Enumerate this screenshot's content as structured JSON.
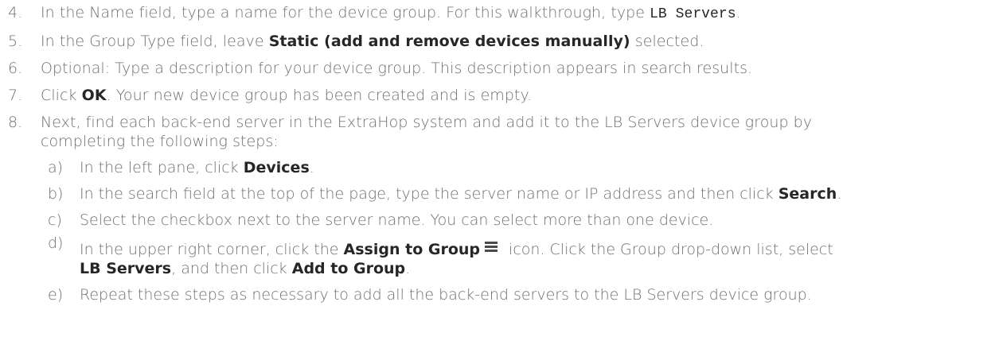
{
  "steps": {
    "s4": {
      "number": "4.",
      "text_a": "In the Name field, type a name for the device group. For this walkthrough, type ",
      "code": "LB Servers",
      "text_b": "."
    },
    "s5": {
      "number": "5.",
      "text_a": "In the Group Type field, leave ",
      "bold": "Static (add and remove devices manually)",
      "text_b": " selected."
    },
    "s6": {
      "number": "6.",
      "text": "Optional: Type a description for your device group. This description appears in search results."
    },
    "s7": {
      "number": "7.",
      "text_a": "Click ",
      "bold": "OK",
      "text_b": ". Your new device group has been created and is empty."
    },
    "s8": {
      "number": "8.",
      "line1": "Next, find each back-end server in the ExtraHop system and add it to the LB Servers device group by",
      "line2": "completing the following steps:"
    }
  },
  "substeps": {
    "a": {
      "letter": "a)",
      "text_a": "In the left pane, click ",
      "bold": "Devices",
      "text_b": "."
    },
    "b": {
      "letter": "b)",
      "text_a": "In the search field at the top of the page, type the server name or IP address and then click ",
      "bold": "Search",
      "text_b": "."
    },
    "c": {
      "letter": "c)",
      "text": "Select the checkbox next to the server name. You can select more than one device."
    },
    "d": {
      "letter": "d)",
      "text_a": "In the upper right corner, click the ",
      "bold_a": "Assign to Group",
      "text_b": " icon. Click the Group drop-down list, select",
      "bold_b": "LB Servers",
      "text_c": ", and then click ",
      "bold_c": "Add to Group",
      "text_d": "."
    },
    "e": {
      "letter": "e)",
      "text": "Repeat these steps as necessary to add all the back-end servers to the LB Servers device group."
    }
  },
  "icons": {
    "assign_to_group": "list-icon"
  }
}
